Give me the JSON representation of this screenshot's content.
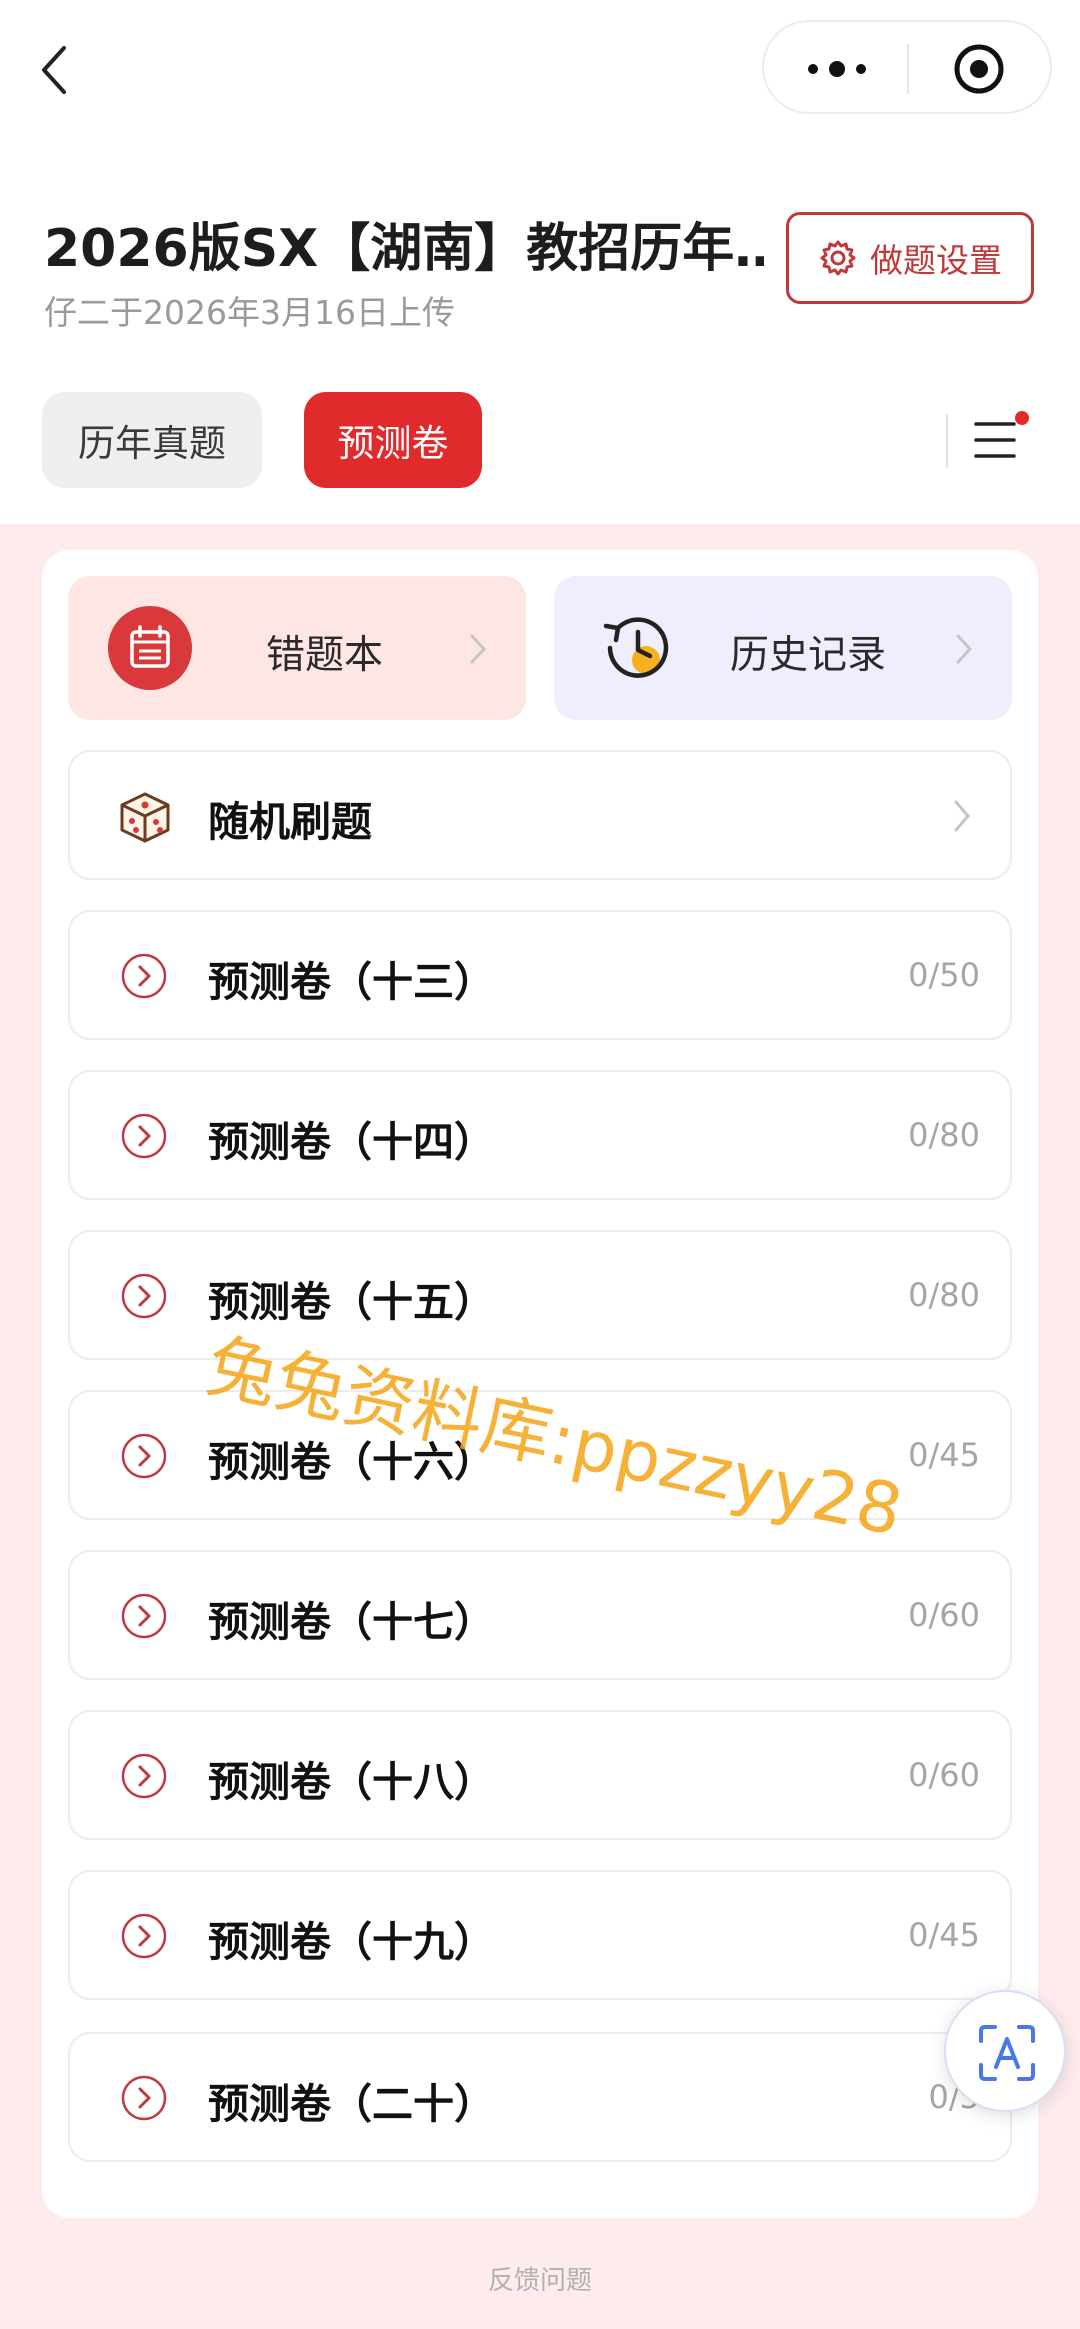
{
  "header": {
    "title": "2026版SX【湖南】教招历年…",
    "subtitle": "仔二于2026年3月16日上传",
    "settings_label": "做题设置"
  },
  "tabs": [
    {
      "label": "历年真题",
      "active": false
    },
    {
      "label": "预测卷",
      "active": true
    }
  ],
  "quick_actions": {
    "wrong_book": "错题本",
    "history": "历史记录"
  },
  "random": "随机刷题",
  "papers": [
    {
      "label": "预测卷（十三）",
      "progress": "0/50"
    },
    {
      "label": "预测卷（十四）",
      "progress": "0/80"
    },
    {
      "label": "预测卷（十五）",
      "progress": "0/80"
    },
    {
      "label": "预测卷（十六）",
      "progress": "0/45"
    },
    {
      "label": "预测卷（十七）",
      "progress": "0/60"
    },
    {
      "label": "预测卷（十八）",
      "progress": "0/60"
    },
    {
      "label": "预测卷（十九）",
      "progress": "0/45"
    },
    {
      "label": "预测卷（二十）",
      "progress": "0/5"
    }
  ],
  "feedback": "反馈问题",
  "watermark": "兔兔资料库:ppzzyy28",
  "colors": {
    "accent": "#e02a2c",
    "accent_dark": "#c0393b",
    "panel_bg": "#fdeceb"
  },
  "icons": {
    "back": "back-icon",
    "more": "more-icon",
    "target": "target-icon",
    "settings": "gear-icon",
    "menu": "menu-icon",
    "wrong_book": "calendar-icon",
    "history": "clock-history-icon",
    "random": "dice-icon",
    "paper": "chevron-circle-icon",
    "float": "text-scan-icon"
  }
}
